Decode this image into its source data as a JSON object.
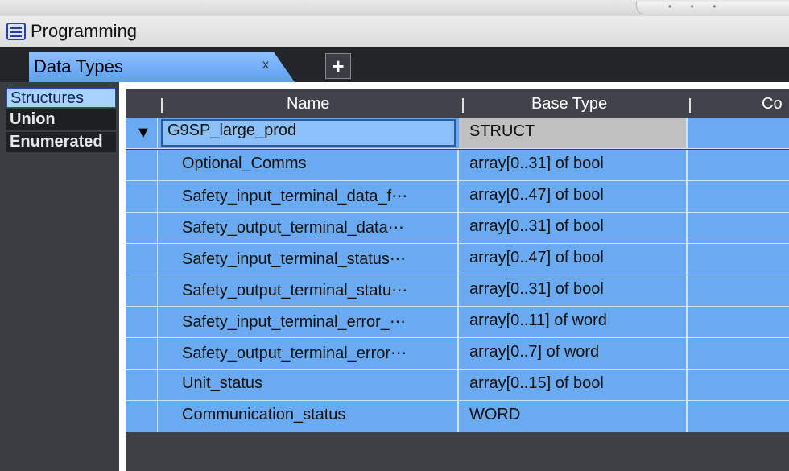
{
  "window": {
    "title": "Programming",
    "icon": "list-window-icon"
  },
  "tabs": {
    "active_label": "Data Types",
    "close_glyph": "x",
    "add_glyph": "+"
  },
  "side_panel": {
    "items": [
      "Structures",
      "Union",
      "Enumerated"
    ],
    "selected": "Structures"
  },
  "table": {
    "headers": {
      "name": "Name",
      "base_type": "Base Type",
      "comment": "Co"
    },
    "root": {
      "name": "G9SP_large_prod",
      "base_type": "STRUCT",
      "expand_glyph": "▼"
    },
    "rows": [
      {
        "name": "Optional_Comms",
        "base_type": "array[0..31] of bool"
      },
      {
        "name": "Safety_input_terminal_data_f⋯",
        "base_type": "array[0..47] of bool"
      },
      {
        "name": "Safety_output_terminal_data⋯",
        "base_type": "array[0..31] of bool"
      },
      {
        "name": "Safety_input_terminal_status⋯",
        "base_type": "array[0..47] of bool"
      },
      {
        "name": "Safety_output_terminal_statu⋯",
        "base_type": "array[0..31] of bool"
      },
      {
        "name": "Safety_input_terminal_error_⋯",
        "base_type": "array[0..11] of word"
      },
      {
        "name": "Safety_output_terminal_error⋯",
        "base_type": "array[0..7] of word"
      },
      {
        "name": "Unit_status",
        "base_type": "array[0..15] of bool"
      },
      {
        "name": "Communication_status",
        "base_type": "WORD"
      }
    ]
  },
  "colors": {
    "row_blue": "#6aaaf0",
    "selected_side": "#a9d3ff",
    "tab_blue": "#5d9ff0",
    "dark_bg": "#3a3d42"
  }
}
